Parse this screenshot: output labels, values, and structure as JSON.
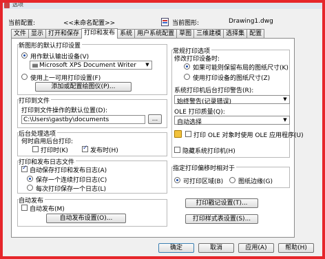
{
  "window": {
    "title": "选项"
  },
  "profile": {
    "current_profile_label": "当前配置:",
    "current_profile_value": "<<未命名配置>>",
    "current_drawing_label": "当前图形:",
    "current_drawing_value": "Drawing1.dwg"
  },
  "tabs": [
    "文件",
    "显示",
    "打开和保存",
    "打印和发布",
    "系统",
    "用户系统配置",
    "草图",
    "三维建模",
    "选择集",
    "配置"
  ],
  "default_output": {
    "title": "新图形的默认打印设置",
    "opt1": "用作默认输出设备(V)",
    "device": "Microsoft XPS Document Writer",
    "opt2": "使用上一可用打印设置(F)",
    "add_btn": "添加或配置绘图仪(P)..."
  },
  "print_to_file": {
    "title": "打印到文件",
    "label": "打印到文件操作的默认位置(D):",
    "path": "C:\\Users\\gastby\\documents",
    "browse": "..."
  },
  "background": {
    "title": "后台处理选项",
    "label": "何时启用后台打印:",
    "plot": "打印时(K)",
    "publish": "发布时(H)"
  },
  "log": {
    "title": "打印和发布日志文件",
    "auto_save": "自动保存打印和发布日志(A)",
    "opt1": "保存一个连续打印日志(C)",
    "opt2": "每次打印保存一个日志(L)"
  },
  "auto_publish": {
    "title": "自动发布",
    "check": "自动发布(M)",
    "btn": "自动发布设置(O)..."
  },
  "general": {
    "title": "常规打印选项",
    "paper_label": "修改打印设备时:",
    "paper_opt1": "如果可能则保留布局的图纸尺寸(K)",
    "paper_opt2": "使用打印设备的图纸尺寸(Z)",
    "spool_label": "系统打印机后台打印警告(R):",
    "spool_value": "始终警告(记录错误)",
    "ole_label": "OLE 打印质量(Q):",
    "ole_value": "自动选择",
    "ole_check": "打印 OLE 对象时使用 OLE 应用程序(U)",
    "hide_check": "隐藏系统打印机(H)"
  },
  "offset": {
    "title": "指定打印偏移时相对于",
    "opt1": "可打印区域(B)",
    "opt2": "图纸边缘(G)"
  },
  "stamp_btn": "打印戳记设置(T)...",
  "style_btn": "打印样式表设置(S)...",
  "footer": {
    "ok": "确定",
    "cancel": "取消",
    "apply": "应用(A)",
    "help": "帮助(H)"
  }
}
